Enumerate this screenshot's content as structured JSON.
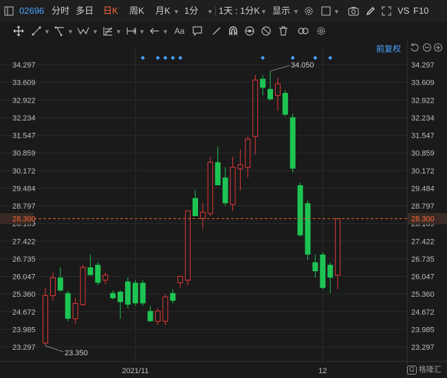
{
  "toolbar": {
    "stock_code": "02696",
    "tabs": [
      "分时",
      "多日",
      "日K",
      "周K",
      "月K",
      "1分"
    ],
    "active_tab": "日K",
    "period_select": "1天 : 1分K",
    "display_label": "显示",
    "vs_label": "VS",
    "f10_label": "F10"
  },
  "adjust_label": "前复权",
  "watermark": "格隆汇",
  "watermark_mark": "G",
  "colors": {
    "up": "#e83a3a",
    "down": "#1ec453",
    "price_line": "#e8632b",
    "accent": "#4aa3ff"
  },
  "chart_data": {
    "type": "candlestick",
    "ylim": [
      22.9,
      34.8
    ],
    "y_ticks": [
      "34.297",
      "33.609",
      "32.922",
      "32.234",
      "31.547",
      "30.859",
      "30.172",
      "29.484",
      "28.797",
      "28.109",
      "27.422",
      "26.735",
      "26.047",
      "25.360",
      "24.672",
      "23.985",
      "23.297"
    ],
    "x_labels": [
      {
        "label": "2021/11",
        "index": 12
      },
      {
        "label": "12",
        "index": 37
      }
    ],
    "current_price": "28.300",
    "max_label": "34.050",
    "min_label": "23.350",
    "marker_indices": [
      13,
      15,
      16,
      17,
      18,
      29,
      33,
      36,
      38
    ],
    "candles": [
      {
        "o": 23.45,
        "h": 25.6,
        "l": 23.35,
        "c": 25.3
      },
      {
        "o": 25.3,
        "h": 26.2,
        "l": 25.1,
        "c": 26.0
      },
      {
        "o": 26.0,
        "h": 26.4,
        "l": 25.45,
        "c": 25.5
      },
      {
        "o": 25.4,
        "h": 25.5,
        "l": 24.3,
        "c": 24.4
      },
      {
        "o": 24.4,
        "h": 25.2,
        "l": 24.2,
        "c": 25.0
      },
      {
        "o": 24.95,
        "h": 26.5,
        "l": 24.9,
        "c": 26.4
      },
      {
        "o": 26.4,
        "h": 26.9,
        "l": 26.1,
        "c": 26.1
      },
      {
        "o": 26.5,
        "h": 26.6,
        "l": 25.7,
        "c": 25.8
      },
      {
        "o": 25.9,
        "h": 26.2,
        "l": 25.75,
        "c": 26.1
      },
      {
        "o": 25.4,
        "h": 25.5,
        "l": 25.15,
        "c": 25.2
      },
      {
        "o": 25.45,
        "h": 25.5,
        "l": 24.4,
        "c": 25.05
      },
      {
        "o": 25.85,
        "h": 26.0,
        "l": 24.8,
        "c": 24.95
      },
      {
        "o": 25.8,
        "h": 25.9,
        "l": 24.9,
        "c": 25.0
      },
      {
        "o": 25.8,
        "h": 25.9,
        "l": 24.9,
        "c": 25.0
      },
      {
        "o": 24.7,
        "h": 24.9,
        "l": 24.3,
        "c": 24.3
      },
      {
        "o": 24.3,
        "h": 24.8,
        "l": 24.15,
        "c": 24.7
      },
      {
        "o": 24.3,
        "h": 25.35,
        "l": 24.15,
        "c": 25.25
      },
      {
        "o": 25.4,
        "h": 25.55,
        "l": 25.0,
        "c": 25.1
      },
      {
        "o": 25.8,
        "h": 26.0,
        "l": 25.6,
        "c": 26.05
      },
      {
        "o": 25.9,
        "h": 28.6,
        "l": 25.7,
        "c": 28.6
      },
      {
        "o": 29.1,
        "h": 29.4,
        "l": 28.4,
        "c": 28.4
      },
      {
        "o": 28.3,
        "h": 28.9,
        "l": 27.9,
        "c": 28.55
      },
      {
        "o": 28.5,
        "h": 30.7,
        "l": 28.4,
        "c": 30.5
      },
      {
        "o": 30.5,
        "h": 31.1,
        "l": 29.6,
        "c": 29.6
      },
      {
        "o": 29.9,
        "h": 30.3,
        "l": 28.8,
        "c": 28.9
      },
      {
        "o": 28.85,
        "h": 30.7,
        "l": 28.6,
        "c": 30.3
      },
      {
        "o": 30.25,
        "h": 31.0,
        "l": 29.4,
        "c": 30.4
      },
      {
        "o": 30.3,
        "h": 31.5,
        "l": 29.9,
        "c": 31.4
      },
      {
        "o": 31.5,
        "h": 33.9,
        "l": 30.8,
        "c": 33.7
      },
      {
        "o": 33.75,
        "h": 33.9,
        "l": 33.1,
        "c": 33.4
      },
      {
        "o": 33.35,
        "h": 34.05,
        "l": 32.9,
        "c": 32.95
      },
      {
        "o": 33.1,
        "h": 33.8,
        "l": 32.5,
        "c": 33.55
      },
      {
        "o": 33.2,
        "h": 33.3,
        "l": 32.3,
        "c": 32.35
      },
      {
        "o": 32.25,
        "h": 32.4,
        "l": 30.1,
        "c": 30.25
      },
      {
        "o": 29.6,
        "h": 29.7,
        "l": 27.6,
        "c": 27.65
      },
      {
        "o": 28.9,
        "h": 29.0,
        "l": 26.7,
        "c": 26.9
      },
      {
        "o": 26.6,
        "h": 26.9,
        "l": 26.0,
        "c": 26.25
      },
      {
        "o": 26.9,
        "h": 27.0,
        "l": 25.55,
        "c": 25.6
      },
      {
        "o": 26.5,
        "h": 26.6,
        "l": 25.4,
        "c": 26.0
      },
      {
        "o": 26.1,
        "h": 28.3,
        "l": 25.55,
        "c": 28.3
      }
    ]
  }
}
